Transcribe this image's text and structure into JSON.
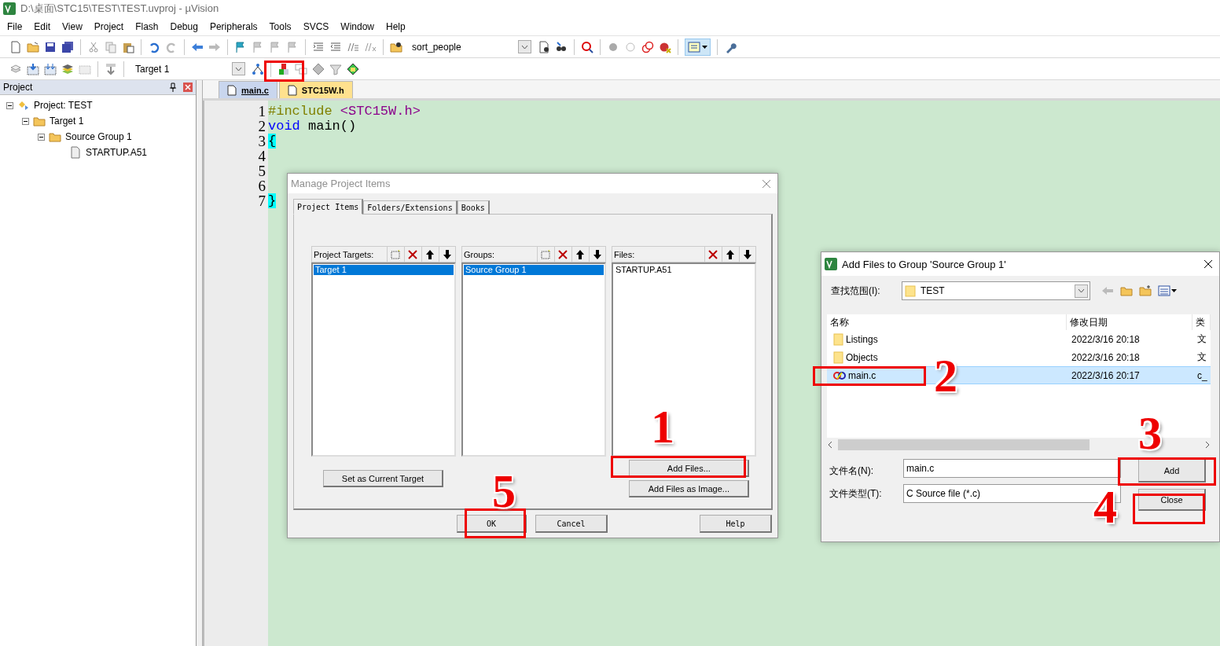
{
  "window": {
    "title": "D:\\桌面\\STC15\\TEST\\TEST.uvproj - µVision"
  },
  "menu": [
    "File",
    "Edit",
    "View",
    "Project",
    "Flash",
    "Debug",
    "Peripherals",
    "Tools",
    "SVCS",
    "Window",
    "Help"
  ],
  "toolbar": {
    "find_field": {
      "value": "sort_people"
    },
    "target_field": {
      "value": "Target 1"
    }
  },
  "project_panel": {
    "title": "Project",
    "tree": [
      {
        "label": "Project: TEST",
        "expanded": true,
        "children": [
          {
            "label": "Target 1",
            "expanded": true,
            "children": [
              {
                "label": "Source Group 1",
                "expanded": true,
                "children": [
                  {
                    "label": "STARTUP.A51"
                  }
                ]
              }
            ]
          }
        ]
      }
    ]
  },
  "editor": {
    "tabs": [
      {
        "label": "main.c",
        "selected": true
      },
      {
        "label": "STC15W.h",
        "selected": false
      }
    ],
    "lines": [
      {
        "number": "1",
        "tokens": [
          {
            "kind": "directive",
            "text": "#include"
          },
          {
            "kind": "header",
            "text": " <STC15W.h>"
          }
        ]
      },
      {
        "number": "2",
        "tokens": [
          {
            "kind": "keyword",
            "text": "void"
          },
          {
            "kind": "plain",
            "text": " main()"
          }
        ]
      },
      {
        "number": "3",
        "tokens": [
          {
            "kind": "brace",
            "text": "{"
          }
        ]
      },
      {
        "number": "4"
      },
      {
        "number": "5"
      },
      {
        "number": "6"
      },
      {
        "number": "7",
        "tokens": [
          {
            "kind": "brace",
            "text": "}"
          }
        ]
      }
    ]
  },
  "manage_dialog": {
    "title": "Manage Project Items",
    "tabs": [
      {
        "label": "Project Items",
        "selected": true
      },
      {
        "label": "Folders/Extensions",
        "selected": false
      },
      {
        "label": "Books",
        "selected": false
      }
    ],
    "lists": [
      {
        "title": "Project Targets:",
        "new_button": true,
        "items": [
          {
            "label": "Target 1",
            "selected": true
          }
        ]
      },
      {
        "title": "Groups:",
        "new_button": true,
        "items": [
          {
            "label": "Source Group 1",
            "selected": true
          }
        ]
      },
      {
        "title": "Files:",
        "items": [
          {
            "label": "STARTUP.A51",
            "selected": false
          }
        ]
      }
    ],
    "target_button": "Set as Current Target",
    "file_buttons": [
      "Add Files...",
      "Add Files as Image..."
    ],
    "footer_buttons": [
      "OK",
      "Cancel",
      "Help"
    ]
  },
  "add_dialog": {
    "title": "Add Files to Group 'Source Group 1'",
    "look_in_label": "查找范围(I):",
    "look_in": "TEST",
    "columns": [
      "名称",
      "修改日期",
      "类"
    ],
    "rows": [
      {
        "kind": "folder",
        "name": "Listings",
        "date": "2022/3/16 20:18",
        "type": "文",
        "selected": false
      },
      {
        "kind": "folder",
        "name": "Objects",
        "date": "2022/3/16 20:18",
        "type": "文",
        "selected": false
      },
      {
        "kind": "cfile",
        "name": "main.c",
        "date": "2022/3/16 20:17",
        "type": "c_",
        "selected": true
      }
    ],
    "filename_label": "文件名(N):",
    "filename": "main.c",
    "filetype_label": "文件类型(T):",
    "filetype": "C Source file (*.c)",
    "buttons": [
      "Add",
      "Close"
    ]
  },
  "annotations": [
    {
      "label": "1"
    },
    {
      "label": "2"
    },
    {
      "label": "3"
    },
    {
      "label": "4"
    },
    {
      "label": "5"
    }
  ]
}
